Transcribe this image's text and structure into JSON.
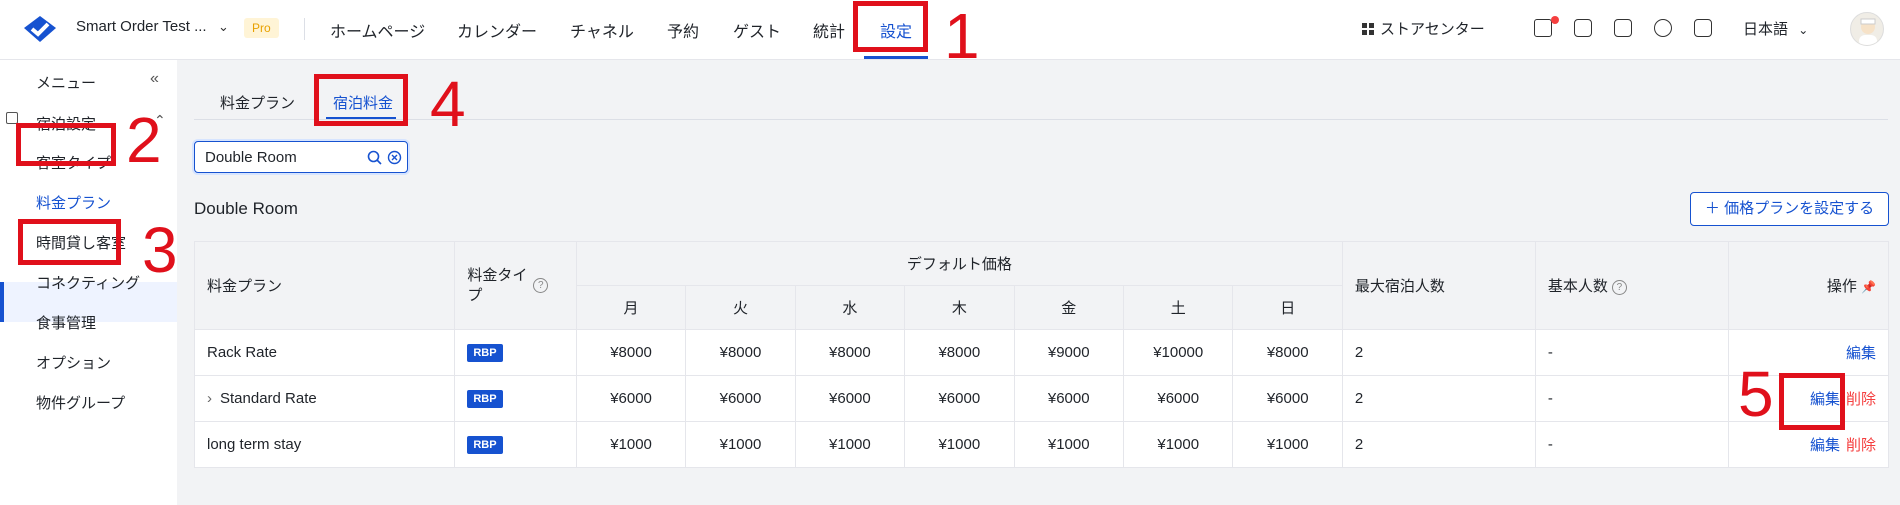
{
  "header": {
    "brand": "Smart Order Test ...",
    "pro_badge": "Pro",
    "nav": [
      "ホームページ",
      "カレンダー",
      "チャネル",
      "予約",
      "ゲスト",
      "統計",
      "設定"
    ],
    "store_center": "ストアセンター",
    "language": "日本語"
  },
  "sidebar": {
    "menu_label": "メニュー",
    "collapse_icon": "«",
    "section": "宿泊設定",
    "items": [
      "客室タイプ",
      "料金プラン",
      "時間貸し客室",
      "コネクティング",
      "食事管理",
      "オプション",
      "物件グループ"
    ]
  },
  "tabs": [
    "料金プラン",
    "宿泊料金"
  ],
  "search": {
    "value": "Double Room"
  },
  "room_title": "Double Room",
  "add_button": "＋ 価格プランを設定する",
  "table": {
    "headers": {
      "plan": "料金プラン",
      "type": "料金タイプ",
      "default_price": "デフォルト価格",
      "days": [
        "月",
        "火",
        "水",
        "木",
        "金",
        "土",
        "日"
      ],
      "max_guests": "最大宿泊人数",
      "base_guests": "基本人数",
      "action": "操作"
    },
    "rows": [
      {
        "name": "Rack Rate",
        "type": "RBP",
        "prices": [
          "¥8000",
          "¥8000",
          "¥8000",
          "¥8000",
          "¥9000",
          "¥10000",
          "¥8000"
        ],
        "max": "2",
        "base": "-",
        "edit": "編集",
        "delete": ""
      },
      {
        "name": "Standard Rate",
        "type": "RBP",
        "prices": [
          "¥6000",
          "¥6000",
          "¥6000",
          "¥6000",
          "¥6000",
          "¥6000",
          "¥6000"
        ],
        "max": "2",
        "base": "-",
        "edit": "編集",
        "delete": "削除"
      },
      {
        "name": "long term stay",
        "type": "RBP",
        "prices": [
          "¥1000",
          "¥1000",
          "¥1000",
          "¥1000",
          "¥1000",
          "¥1000",
          "¥1000"
        ],
        "max": "2",
        "base": "-",
        "edit": "編集",
        "delete": "削除"
      }
    ]
  },
  "annotations": [
    "1",
    "2",
    "3",
    "4",
    "5"
  ],
  "colors": {
    "accent": "#1652d0",
    "annotation": "#e0101b",
    "danger": "#f53f3f"
  }
}
